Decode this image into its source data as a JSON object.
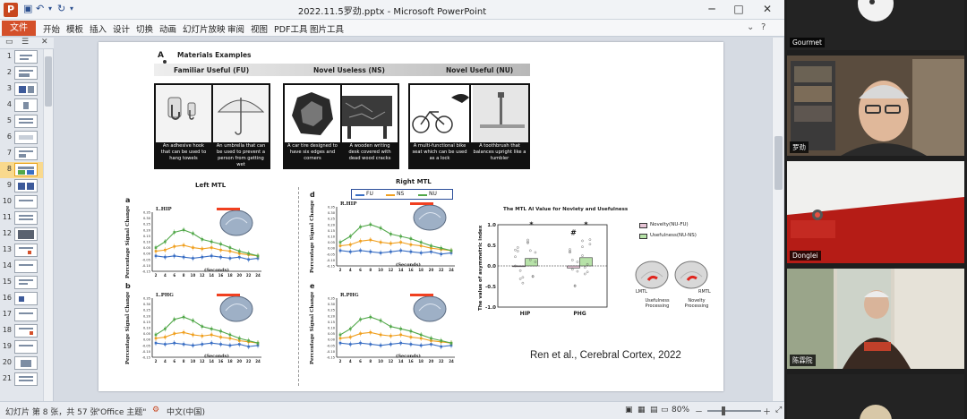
{
  "window": {
    "title": "2022.11.5罗劲.pptx - Microsoft PowerPoint",
    "app_icon": "P",
    "minimize": "─",
    "maximize": "□",
    "close": "✕"
  },
  "ribbon": {
    "file_tab": "文件",
    "tabs": [
      "开始",
      "模板",
      "插入",
      "设计",
      "切换",
      "动画",
      "幻灯片放映",
      "审阅",
      "视图",
      "PDF工具",
      "图片工具"
    ],
    "help": "?"
  },
  "thumbnails": {
    "numbers": [
      "1",
      "2",
      "3",
      "4",
      "5",
      "6",
      "7",
      "8",
      "9",
      "10",
      "11",
      "12",
      "13",
      "14",
      "15",
      "16",
      "17",
      "18",
      "19",
      "20",
      "21"
    ],
    "active": "8"
  },
  "slide": {
    "section_label": "A",
    "title": "Materials Examples",
    "categories": [
      "Familiar Useful (FU)",
      "Novel Useless (NS)",
      "Novel Useful (NU)"
    ],
    "captions": [
      "An adhesive hook that can be used to hang towels",
      "An umbrella that can be used to prevent a person from getting wet",
      "A car tire designed to have six edges and corners",
      "A wooden writing desk covered with dead wood cracks",
      "A multi-functional bike seat which can be used as a lock",
      "A toothbrush that balances upright like a tumbler"
    ],
    "left_header": "Left MTL",
    "right_header": "Right MTL",
    "legend": [
      "FU",
      "NS",
      "NU"
    ],
    "panels": [
      {
        "letter": "a",
        "region": "L.HIP"
      },
      {
        "letter": "b",
        "region": "L.PHG"
      },
      {
        "letter": "d",
        "region": "R.HIP"
      },
      {
        "letter": "e",
        "region": "R.PHG"
      }
    ],
    "ylabel": "Percentage Signal Change",
    "xlabel": "(Seconds)",
    "yticks": [
      "0.35",
      "0.30",
      "0.25",
      "0.20",
      "0.15",
      "0.10",
      "0.05",
      "0.00",
      "-0.05",
      "-0.10",
      "-0.15"
    ],
    "xticks": [
      "2",
      "4",
      "6",
      "8",
      "10",
      "12",
      "14",
      "16",
      "18",
      "20",
      "22",
      "24"
    ],
    "ai_title": "The MTL AI Value for Novlety and Usefulness",
    "ai_ylabel": "The value of asymmetric index",
    "ai_yticks": [
      "1.0",
      "0.5",
      "0.0",
      "-0.5",
      "-1.0"
    ],
    "ai_xticks": [
      "HIP",
      "PHG"
    ],
    "ai_legend": [
      "Novelty(NU-FU)",
      "Usefulness(NU-NS)"
    ],
    "ai_marks": [
      "*",
      "#",
      "*"
    ],
    "brain_labels": [
      "LMTL",
      "RMTL"
    ],
    "brain_captions": [
      "Usefulness Processing",
      "Novelty Processing"
    ],
    "citation": "Ren et al., Cerebral Cortex, 2022"
  },
  "status_bar": {
    "slide_info": "幻灯片 第 8 张，共 57 张",
    "theme": "\"Office 主题\"",
    "language": "中文(中国)",
    "zoom": "80%",
    "zoom_minus": "－",
    "zoom_plus": "＋"
  },
  "video_tiles": [
    {
      "name": "Gourmet"
    },
    {
      "name": "罗劲"
    },
    {
      "name": "Donglei"
    },
    {
      "name": "陈霖院"
    }
  ],
  "colors": {
    "fu": "#3a6fc4",
    "ns": "#f0a020",
    "nu": "#52a84a",
    "accent_orange": "#d4502a",
    "active_thumb": "#f9d98d"
  },
  "chart_data": {
    "type": "bar",
    "title": "The MTL AI Value for Novlety and Usefulness",
    "ylabel": "The value of asymmetric index",
    "categories": [
      "HIP",
      "PHG"
    ],
    "series": [
      {
        "name": "Novelty(NU-FU)",
        "values": [
          0.0,
          -0.05
        ]
      },
      {
        "name": "Usefulness(NU-NS)",
        "values": [
          0.18,
          0.2
        ]
      }
    ],
    "ylim": [
      -1.0,
      1.0
    ]
  }
}
